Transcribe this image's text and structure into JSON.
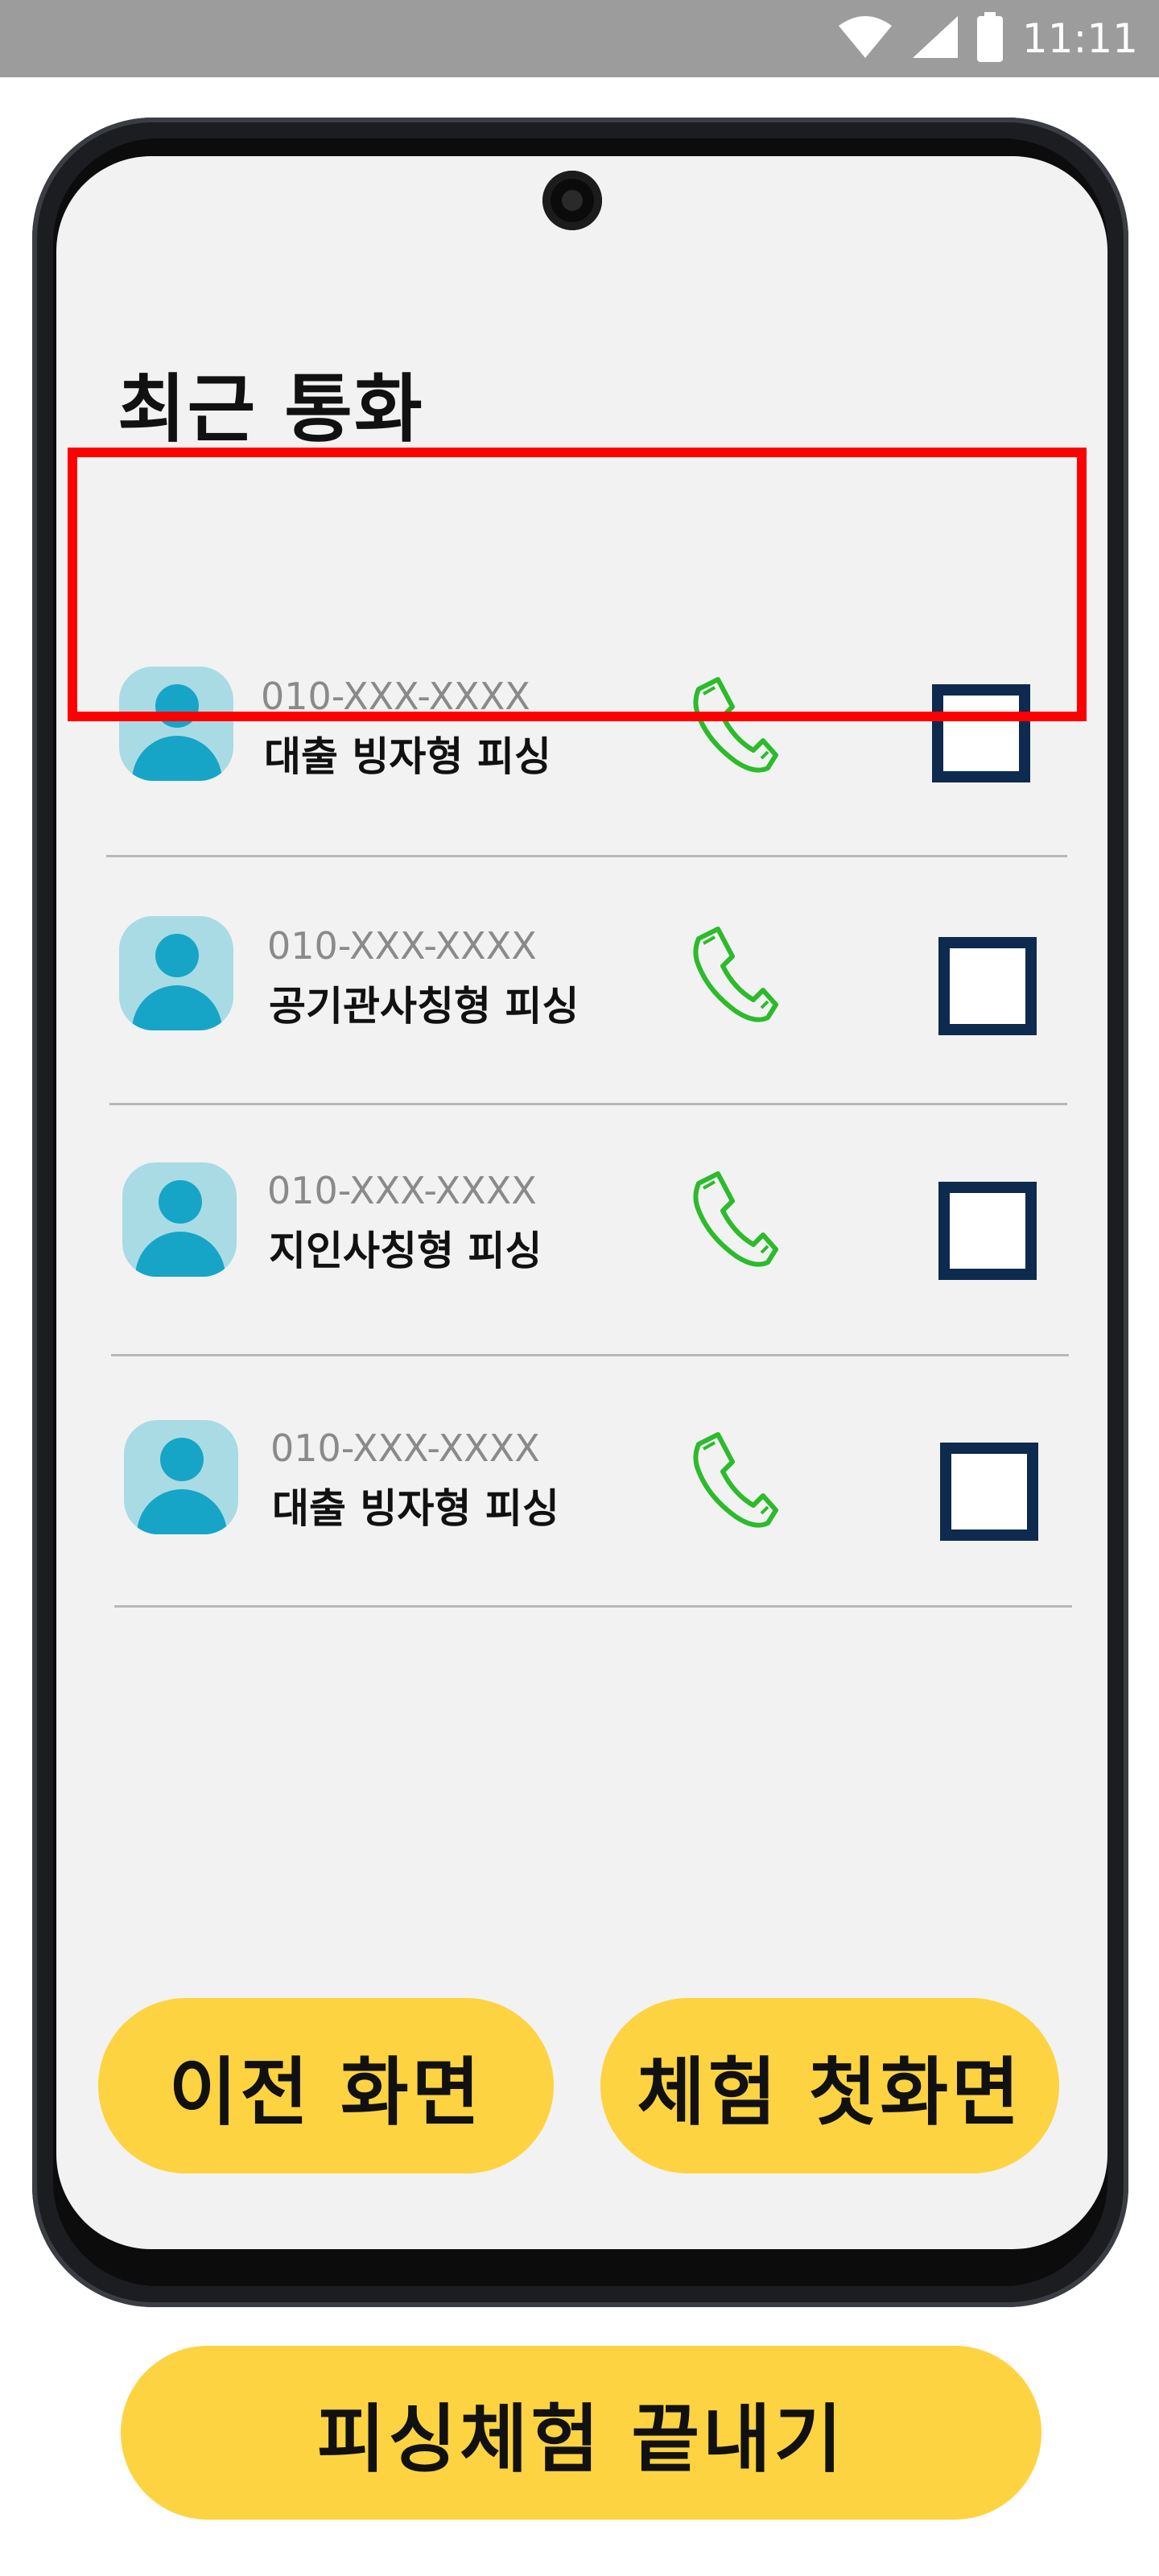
{
  "status_bar": {
    "time": "11:11",
    "icons": [
      "wifi-icon",
      "signal-icon",
      "battery-icon"
    ]
  },
  "screen": {
    "title": "최근 통화",
    "calls": [
      {
        "number": "010-XXX-XXXX",
        "type": "대출 빙자형 피싱",
        "highlighted": true,
        "checked": false
      },
      {
        "number": "010-XXX-XXXX",
        "type": "공기관사칭형 피싱",
        "highlighted": false,
        "checked": false
      },
      {
        "number": "010-XXX-XXXX",
        "type": "지인사칭형 피싱",
        "highlighted": false,
        "checked": false
      },
      {
        "number": "010-XXX-XXXX",
        "type": "대출 빙자형 피싱",
        "highlighted": false,
        "checked": false
      }
    ],
    "buttons": {
      "back": "이전 화면",
      "home": "체험 첫화면"
    }
  },
  "footer": {
    "end_button": "피싱체험 끝내기"
  },
  "colors": {
    "accent_button": "#fdd341",
    "highlight": "#ff0000",
    "call_icon": "#2bbb2b",
    "checkbox_border": "#0e2a4f",
    "avatar_bg": "#a9dbe4",
    "avatar_fg": "#17a5c7"
  }
}
